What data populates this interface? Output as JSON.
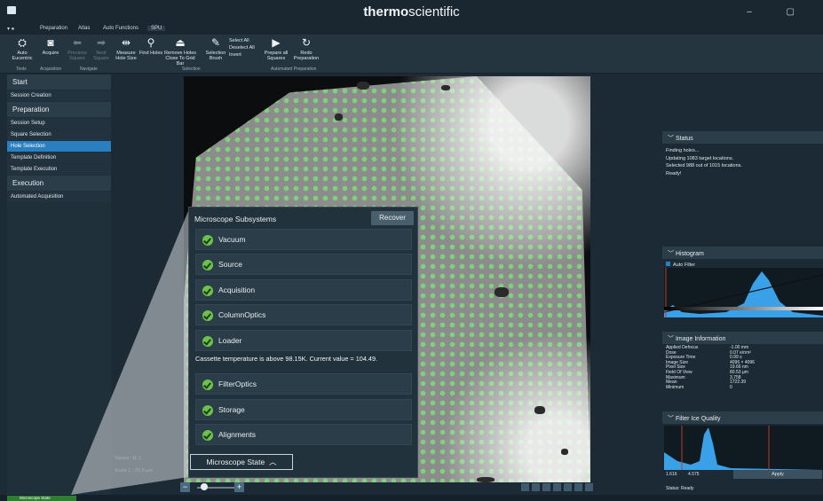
{
  "brand": {
    "part1": "thermo",
    "part2": "scientific"
  },
  "window": {
    "controls": "–  ▢"
  },
  "ribbon": {
    "tabs": [
      {
        "label": "Preparation"
      },
      {
        "label": "Atlas"
      },
      {
        "label": "Auto Functions"
      },
      {
        "label": "SPU"
      }
    ],
    "buttons": [
      {
        "label": "Auto Eucentric",
        "icon": "eucentric-icon"
      },
      {
        "label": "Acquire",
        "icon": "camera-icon"
      },
      {
        "label": "Previous Square",
        "icon": "arrow-left-icon",
        "disabled": true
      },
      {
        "label": "Next Square",
        "icon": "arrow-right-icon",
        "disabled": true
      },
      {
        "label": "Measure Hole Size",
        "icon": "measure-icon"
      },
      {
        "label": "Find Holes",
        "icon": "search-icon"
      },
      {
        "label": "Remove Holes Close To Grid Bar",
        "icon": "remove-holes-icon"
      },
      {
        "label": "Selection Brush",
        "icon": "brush-icon"
      },
      {
        "label": "Prepare all Squares",
        "icon": "play-icon"
      },
      {
        "label": "Redo Preparation",
        "icon": "redo-icon"
      }
    ],
    "selection": [
      "Select All",
      "Deselect All",
      "Invert"
    ],
    "groups": [
      "Tools",
      "Acquisition",
      "Navigate",
      "Selection",
      "Automated Preparation"
    ]
  },
  "nav": {
    "sections": [
      {
        "title": "Start",
        "items": [
          "Session Creation"
        ]
      },
      {
        "title": "Preparation",
        "items": [
          "Session Setup",
          "Square Selection",
          "Hole Selection",
          "Template Definition",
          "Template Execution"
        ]
      },
      {
        "title": "Execution",
        "items": [
          "Automated Acquisition"
        ]
      }
    ],
    "active_item": "Hole Selection"
  },
  "viewer": {
    "scale_label1": "Sqsize: 11.1",
    "scale_label2": "Scale 1 : 25.8 µm"
  },
  "microscope": {
    "title": "Microscope Subsystems",
    "recover_label": "Recover",
    "subsystems": [
      "Vacuum",
      "Source",
      "Acquisition",
      "ColumnOptics",
      "Loader",
      "FilterOptics",
      "Storage",
      "Alignments"
    ],
    "warning": "Cassette temperature is above 98.15K. Current value = 104.49.",
    "state_button": "Microscope State",
    "state_icon": "chevron-up-icon",
    "status_color": "#6cc24a"
  },
  "status_panel": {
    "title": "Status",
    "lines": [
      "Finding holes...",
      "Updating 1083 target locations.",
      "Selected 988 out of 1015 locations.",
      "Ready!"
    ]
  },
  "histogram": {
    "title": "Histogram",
    "auto_filter": "Auto Filter"
  },
  "image_info": {
    "title": "Image Information",
    "rows": [
      [
        "Applied Defocus",
        "-1.00 mm"
      ],
      [
        "Dose",
        "0.07 e/nm²"
      ],
      [
        "Exposure Time",
        "0.99 s"
      ],
      [
        "Image Size",
        "4096 × 4096"
      ],
      [
        "Pixel Size",
        "19.66 nm"
      ],
      [
        "Field Of View",
        "80.53 µm"
      ],
      [
        "Maximum",
        "3,758"
      ],
      [
        "Mean",
        "1722.39"
      ],
      [
        "Minimum",
        "0"
      ]
    ]
  },
  "ice_quality": {
    "title": "Filter Ice Quality",
    "min_value": "1.616",
    "max_value": "4.575",
    "apply_label": "Apply",
    "status": "Status: Ready"
  },
  "bottom": {
    "microscope_status": "Microscope State"
  },
  "colors": {
    "accent": "#2a7fc1",
    "ok": "#6cc24a",
    "hole": "#7fd07c",
    "histogram": "#3aa0e8"
  }
}
